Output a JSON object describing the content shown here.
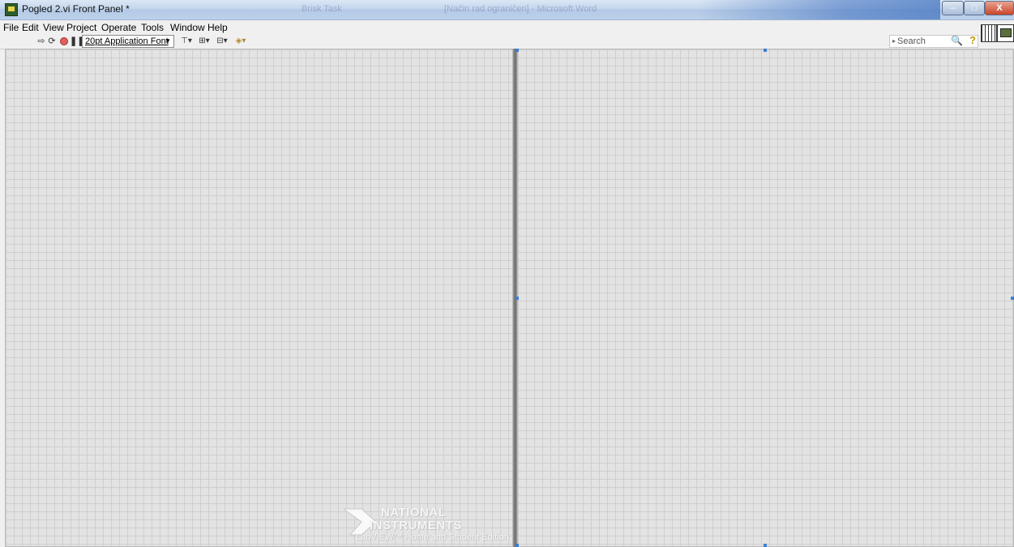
{
  "window": {
    "title": "Pogled 2.vi Front Panel *",
    "background_titles": [
      "Brisk Task",
      "[Način rad ograničen] - Microsoft Word"
    ],
    "buttons": {
      "minimize": "–",
      "maximize": "□",
      "close": "X"
    }
  },
  "menu": [
    "File",
    "Edit",
    "View",
    "Project",
    "Operate",
    "Tools",
    "Window",
    "Help"
  ],
  "toolbar": {
    "font_select": "20pt Application Font",
    "search_placeholder": "Search"
  },
  "watermark": {
    "line1": "NATIONAL",
    "line2": "INSTRUMENTS",
    "line3": "LabVIEW™ Home and Student Edition"
  },
  "colors": {
    "panel_bg": "#e3e3e3",
    "grid": "#cfcfcf",
    "handle": "#3a7fd4"
  }
}
